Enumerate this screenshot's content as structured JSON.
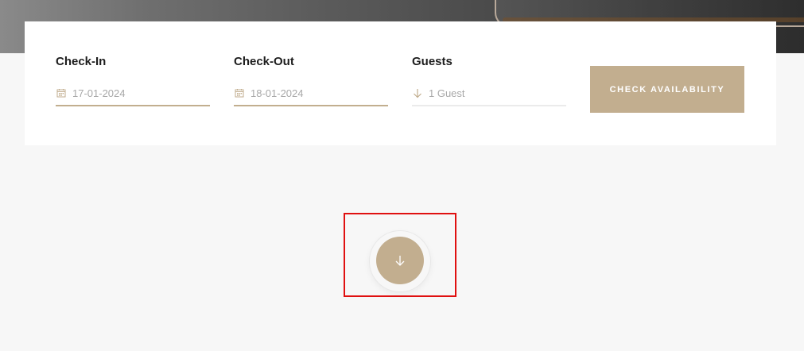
{
  "booking": {
    "checkin": {
      "label": "Check-In",
      "value": "17-01-2024",
      "icon": "calendar-icon"
    },
    "checkout": {
      "label": "Check-Out",
      "value": "18-01-2024",
      "icon": "calendar-icon"
    },
    "guests": {
      "label": "Guests",
      "value": "1 Guest",
      "icon": "arrow-down-icon"
    },
    "button_label": "CHECK AVAILABILITY"
  },
  "scroll": {
    "icon": "arrow-down-icon"
  },
  "colors": {
    "accent": "#c2ae8f",
    "highlight": "#e01010",
    "background": "#f7f7f7",
    "card": "#ffffff"
  }
}
